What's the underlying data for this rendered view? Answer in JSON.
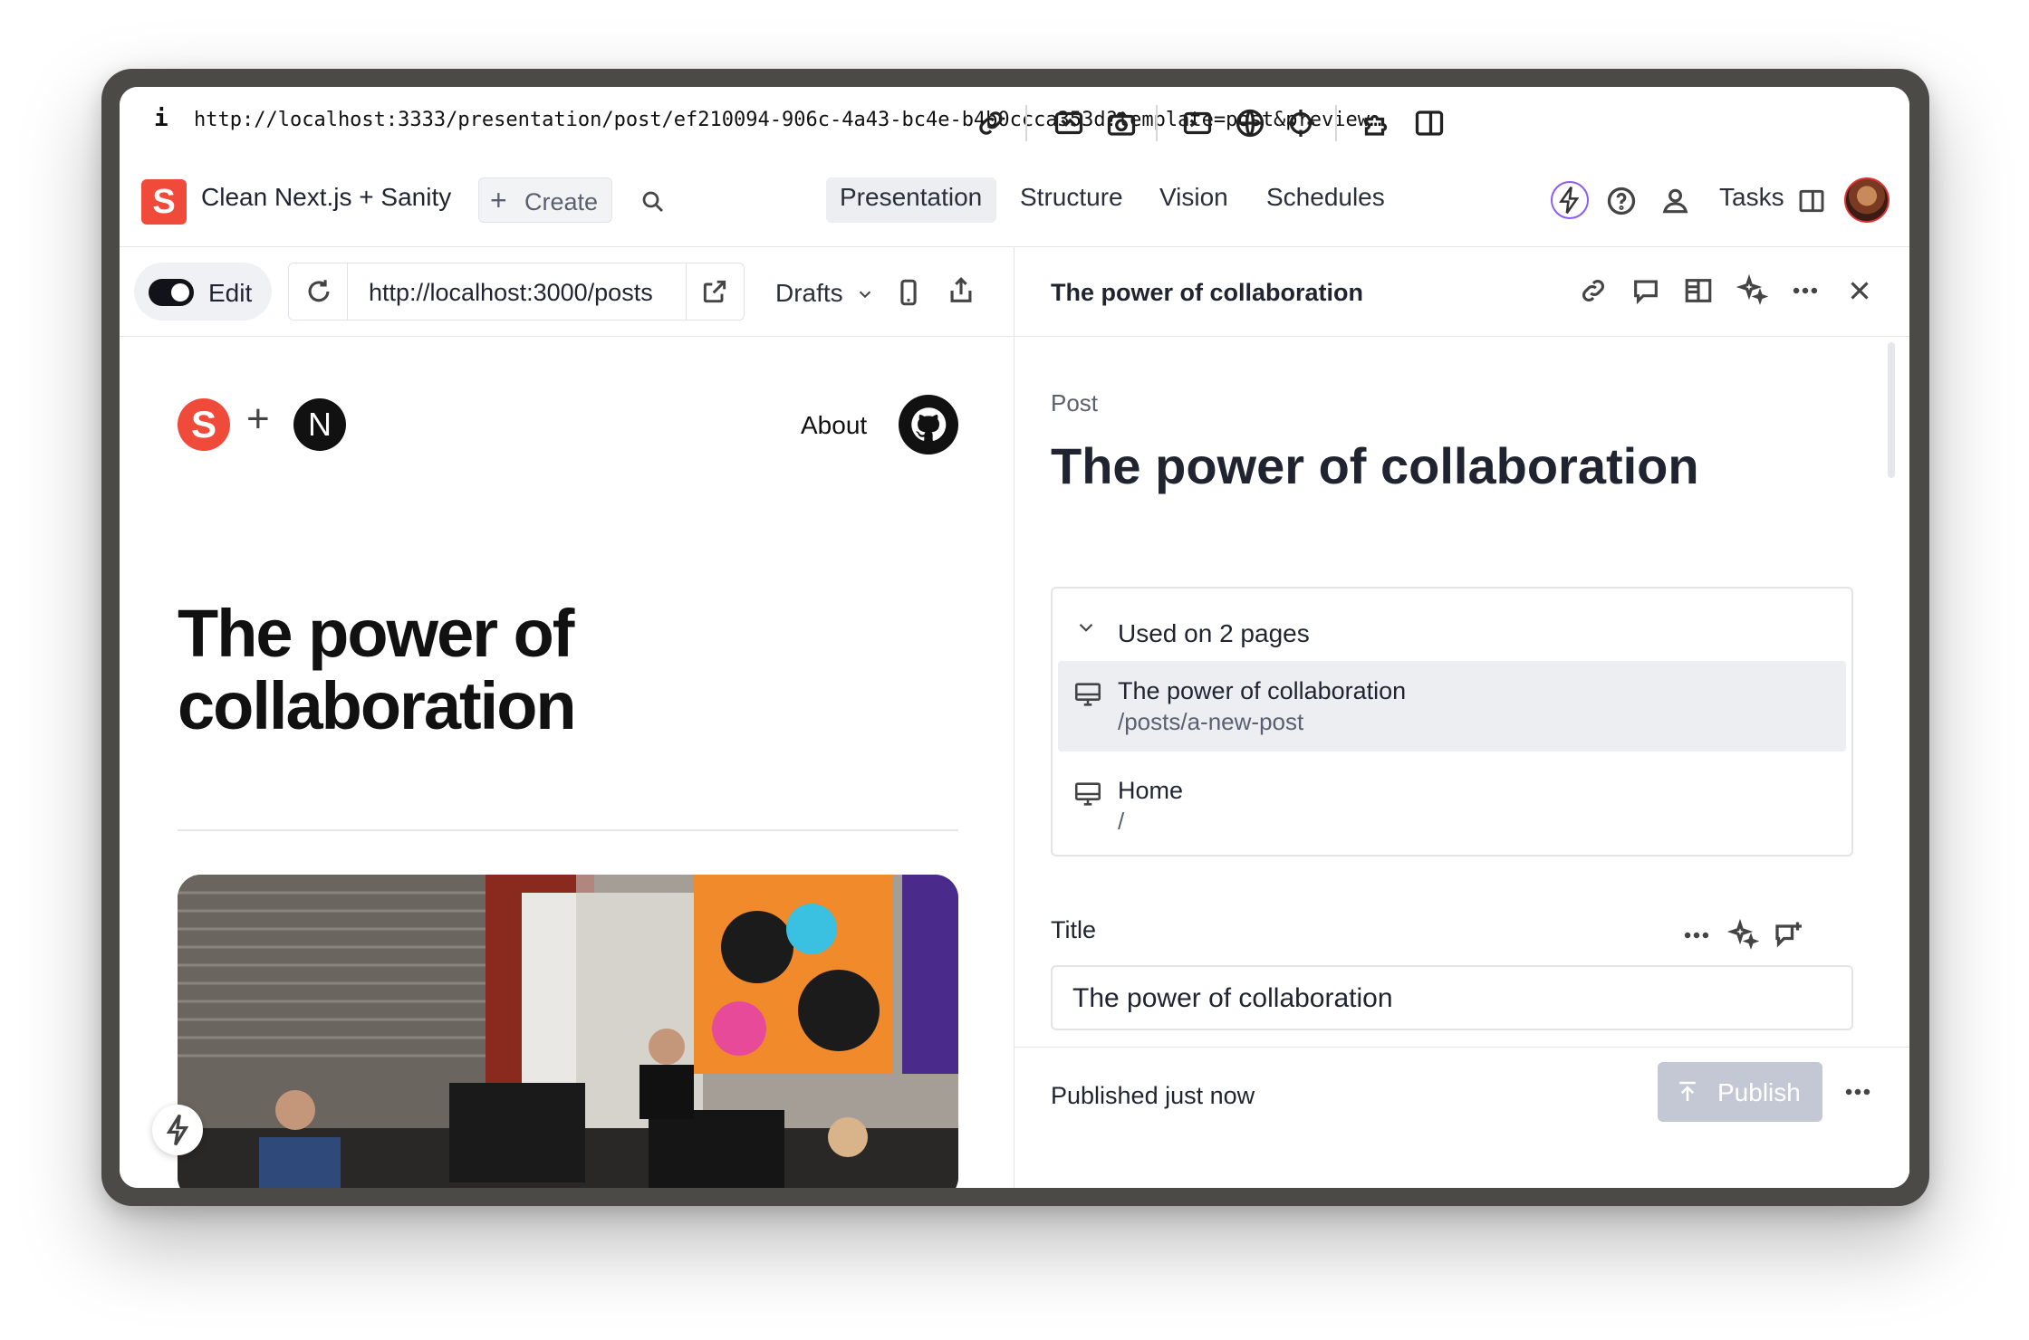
{
  "browser": {
    "info_glyph": "i",
    "url": "http://localhost:3333/presentation/post/ef210094-906c-4a43-bc4e-b4b0ccca353d?template=post&preview…"
  },
  "studio": {
    "logo_letter": "S",
    "title": "Clean Next.js + Sanity",
    "create_label": "Create",
    "nav": [
      "Presentation",
      "Structure",
      "Vision",
      "Schedules"
    ],
    "tasks_label": "Tasks"
  },
  "toolbar": {
    "edit_label": "Edit",
    "preview_url": "http://localhost:3000/posts",
    "perspective_label": "Drafts"
  },
  "document_pane": {
    "header_title": "The power of collaboration",
    "type_label": "Post",
    "heading": "The power of collaboration",
    "used_on": {
      "label": "Used on 2 pages",
      "pages": [
        {
          "title": "The power of collaboration",
          "path": "/posts/a-new-post",
          "selected": true
        },
        {
          "title": "Home",
          "path": "/",
          "selected": false
        }
      ]
    },
    "title_field": {
      "label": "Title",
      "value": "The power of collaboration"
    },
    "footer": {
      "status": "Published just now",
      "publish_label": "Publish"
    }
  },
  "preview": {
    "logo_s": "S",
    "plus": "+",
    "logo_n": "N",
    "about_label": "About",
    "title": "The power of collaboration"
  }
}
